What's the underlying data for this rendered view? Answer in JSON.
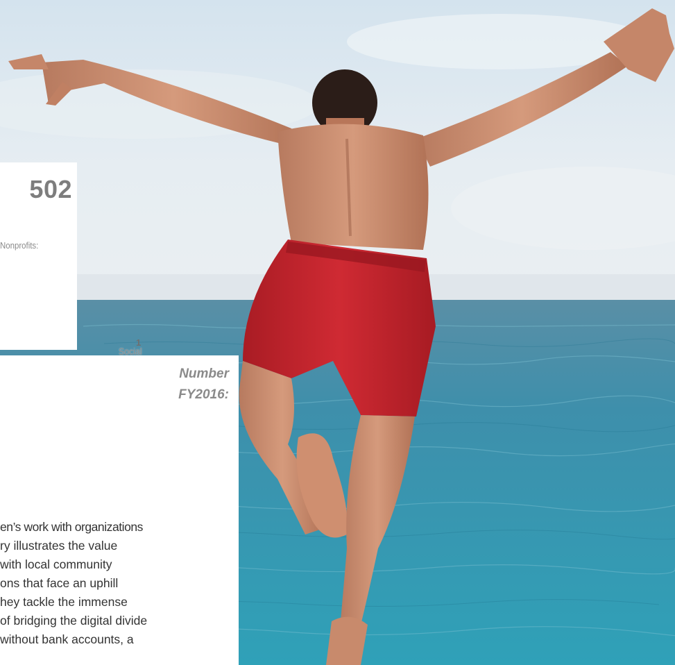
{
  "stats": {
    "nonprofits_count": "502",
    "nonprofits_label": "Nonprofits:",
    "social_welfare_count": "1",
    "social_welfare_label": "Social Welfare Agencies:"
  },
  "heading": {
    "text": "Number\nFY2016:"
  },
  "body": {
    "lines": [
      "en’s work with organizations",
      "ry illustrates the value",
      "with local community",
      "ons that face an uphill",
      "hey tackle the immense",
      "of bridging the digital divide",
      "without bank accounts, a"
    ]
  },
  "colors": {
    "sky_top": "#dfe9f1",
    "sky_bottom": "#e9eef2",
    "sea": "#3e93ad",
    "shorts": "#c0222b",
    "skin": "#c9876a"
  }
}
